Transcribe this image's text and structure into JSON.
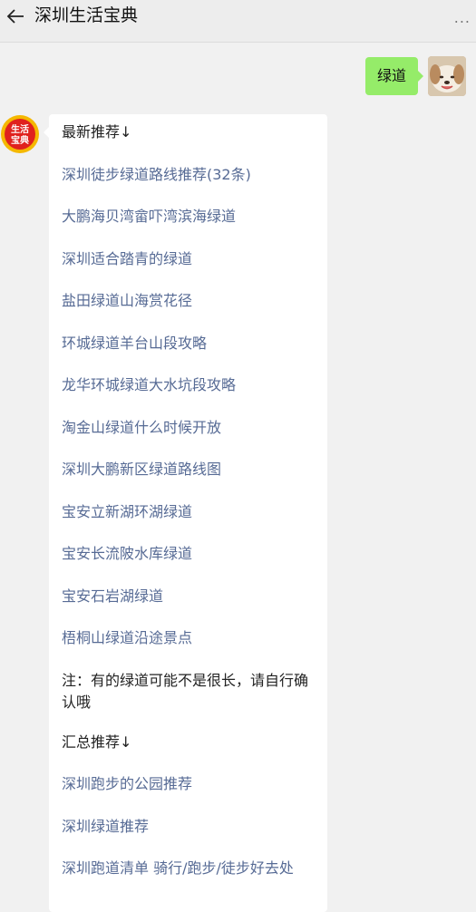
{
  "header": {
    "back_icon": "arrow-left-icon",
    "title": "深圳生活宝典",
    "more_label": "..."
  },
  "sent_message": {
    "text": "绿道"
  },
  "bot": {
    "avatar_text_top": "生活",
    "avatar_text_bottom": "宝典",
    "colors": {
      "avatar_ring": "#f5b800",
      "avatar_fill": "#e0221e"
    }
  },
  "reply": {
    "heading_latest": "最新推荐↓",
    "links_latest": [
      "深圳徒步绿道路线推荐(32条)",
      "大鹏海贝湾畲吓湾滨海绿道",
      "深圳适合踏青的绿道",
      "盐田绿道山海赏花径",
      "环城绿道羊台山段攻略",
      "龙华环城绿道大水坑段攻略",
      "淘金山绿道什么时候开放",
      "深圳大鹏新区绿道路线图",
      "宝安立新湖环湖绿道",
      "宝安长流陂水库绿道",
      "宝安石岩湖绿道",
      "梧桐山绿道沿途景点"
    ],
    "note": "注：有的绿道可能不是很长，请自行确认哦",
    "heading_summary": "汇总推荐↓",
    "links_summary": [
      "深圳跑步的公园推荐",
      "深圳绿道推荐",
      "深圳跑道清单 骑行/跑步/徒步好去处"
    ]
  },
  "colors": {
    "background": "#f1f1f1",
    "header_bg": "#ededed",
    "sent_bubble": "#95ec69",
    "link": "#576b95"
  }
}
